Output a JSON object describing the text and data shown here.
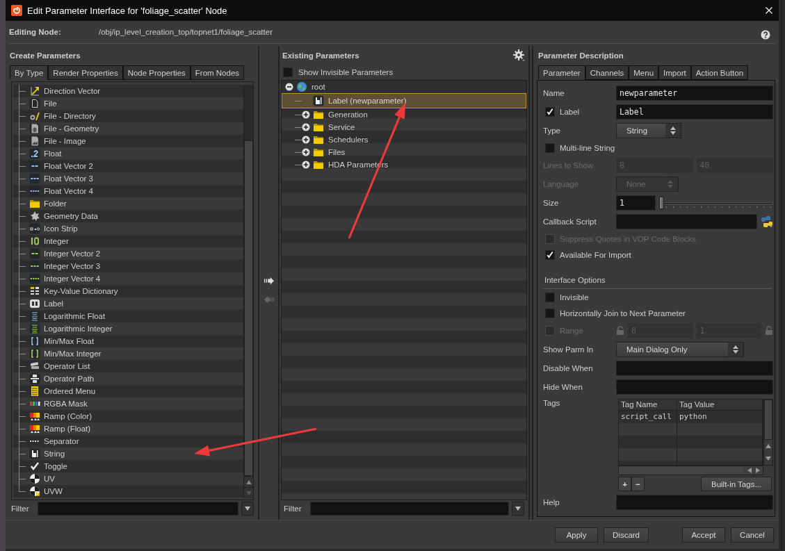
{
  "window": {
    "title": "Edit Parameter Interface for 'foliage_scatter' Node"
  },
  "editing_node": {
    "label": "Editing Node:",
    "path": "/obj/ip_level_creation_top/topnet1/foliage_scatter"
  },
  "create_parameters": {
    "title": "Create Parameters",
    "tabs": [
      {
        "label": "By Type",
        "selected": true
      },
      {
        "label": "Render Properties",
        "selected": false
      },
      {
        "label": "Node Properties",
        "selected": false
      },
      {
        "label": "From Nodes",
        "selected": false
      }
    ],
    "items": [
      {
        "label": "Direction Vector",
        "kind": "direction"
      },
      {
        "label": "File",
        "kind": "file"
      },
      {
        "label": "File - Directory",
        "kind": "file_dir"
      },
      {
        "label": "File - Geometry",
        "kind": "file_geo"
      },
      {
        "label": "File - Image",
        "kind": "file_image"
      },
      {
        "label": "Float",
        "kind": "float"
      },
      {
        "label": "Float Vector 2",
        "kind": "fvec2"
      },
      {
        "label": "Float Vector 3",
        "kind": "fvec3"
      },
      {
        "label": "Float Vector 4",
        "kind": "fvec4"
      },
      {
        "label": "Folder",
        "kind": "folder"
      },
      {
        "label": "Geometry Data",
        "kind": "geo_data"
      },
      {
        "label": "Icon Strip",
        "kind": "icon_strip"
      },
      {
        "label": "Integer",
        "kind": "integer"
      },
      {
        "label": "Integer Vector 2",
        "kind": "ivec2"
      },
      {
        "label": "Integer Vector 3",
        "kind": "ivec3"
      },
      {
        "label": "Integer Vector 4",
        "kind": "ivec4"
      },
      {
        "label": "Key-Value Dictionary",
        "kind": "keyvalue"
      },
      {
        "label": "Label",
        "kind": "label"
      },
      {
        "label": "Logarithmic Float",
        "kind": "log_float"
      },
      {
        "label": "Logarithmic Integer",
        "kind": "log_int"
      },
      {
        "label": "Min/Max Float",
        "kind": "minmax_float"
      },
      {
        "label": "Min/Max Integer",
        "kind": "minmax_int"
      },
      {
        "label": "Operator List",
        "kind": "op_list"
      },
      {
        "label": "Operator Path",
        "kind": "op_path"
      },
      {
        "label": "Ordered Menu",
        "kind": "ordered_menu"
      },
      {
        "label": "RGBA Mask",
        "kind": "rgba"
      },
      {
        "label": "Ramp (Color)",
        "kind": "ramp"
      },
      {
        "label": "Ramp (Float)",
        "kind": "ramp"
      },
      {
        "label": "Separator",
        "kind": "separator"
      },
      {
        "label": "String",
        "kind": "string"
      },
      {
        "label": "Toggle",
        "kind": "toggle"
      },
      {
        "label": "UV",
        "kind": "uv"
      },
      {
        "label": "UVW",
        "kind": "uvw"
      }
    ],
    "filter": {
      "label": "Filter"
    }
  },
  "existing_parameters": {
    "title": "Existing Parameters",
    "show_invisible": {
      "label": "Show Invisible Parameters",
      "checked": false
    },
    "tree": [
      {
        "label": "root",
        "kind": "root",
        "expanded": true,
        "selected": false,
        "children": [
          {
            "label": "Label (newparameter)",
            "kind": "string",
            "selected": true
          },
          {
            "label": "Generation",
            "kind": "folder",
            "expanded": false,
            "selected": false
          },
          {
            "label": "Service",
            "kind": "folder",
            "expanded": false,
            "selected": false
          },
          {
            "label": "Schedulers",
            "kind": "folder",
            "expanded": false,
            "selected": false
          },
          {
            "label": "Files",
            "kind": "folder",
            "expanded": false,
            "selected": false
          },
          {
            "label": "HDA Parameters",
            "kind": "folder",
            "expanded": false,
            "selected": false
          }
        ]
      }
    ],
    "filter": {
      "label": "Filter"
    }
  },
  "parameter_description": {
    "title": "Parameter Description",
    "tabs": [
      {
        "label": "Parameter",
        "selected": true
      },
      {
        "label": "Channels",
        "selected": false
      },
      {
        "label": "Menu",
        "selected": false
      },
      {
        "label": "Import",
        "selected": false
      },
      {
        "label": "Action Button",
        "selected": false
      }
    ],
    "rows": [
      {
        "kind": "text",
        "label": "Name",
        "value": "newparameter"
      },
      {
        "kind": "check_text",
        "label": "Label",
        "checked": true,
        "value": "Label"
      },
      {
        "kind": "select",
        "label": "Type",
        "value": "String",
        "disabled": false
      },
      {
        "kind": "check",
        "label": "Multi-line String",
        "checked": false,
        "disabled": false
      },
      {
        "kind": "pair",
        "label": "Lines to Show",
        "values": [
          "8",
          "40"
        ],
        "disabled": true
      },
      {
        "kind": "select",
        "label": "Language",
        "value": "None",
        "disabled": true
      },
      {
        "kind": "slider",
        "label": "Size",
        "value": "1",
        "level": 0
      },
      {
        "kind": "script",
        "label": "Callback Script"
      },
      {
        "kind": "check",
        "label": "Suppress Quotes in VOP Code Blocks",
        "checked": false,
        "disabled": true
      },
      {
        "kind": "check",
        "label": "Available For Import",
        "checked": true,
        "disabled": false
      },
      {
        "kind": "section",
        "label": "Interface Options"
      },
      {
        "kind": "check",
        "label": "Invisible",
        "checked": false,
        "disabled": false
      },
      {
        "kind": "check",
        "label": "Horizontally Join to Next Parameter",
        "checked": false,
        "disabled": false
      },
      {
        "kind": "range",
        "label": "Range",
        "checked": false,
        "disabled": true,
        "values": [
          "0",
          "1"
        ]
      },
      {
        "kind": "select",
        "label": "Show Parm In",
        "value": "Main Dialog Only",
        "disabled": false
      },
      {
        "kind": "text",
        "label": "Disable When"
      },
      {
        "kind": "text",
        "label": "Hide When"
      },
      {
        "kind": "tags",
        "label": "Tags",
        "columns": [
          "Tag Name",
          "Tag Value"
        ],
        "rows": [
          [
            "script_call",
            "python"
          ]
        ],
        "buttons": [
          "+",
          "−",
          "Built-in Tags..."
        ]
      },
      {
        "kind": "text",
        "label": "Help"
      }
    ]
  },
  "buttons": [
    "Apply",
    "Discard",
    "Accept",
    "Cancel"
  ],
  "annotations": [
    {
      "kind": "arrow"
    },
    {
      "kind": "arrow"
    }
  ]
}
